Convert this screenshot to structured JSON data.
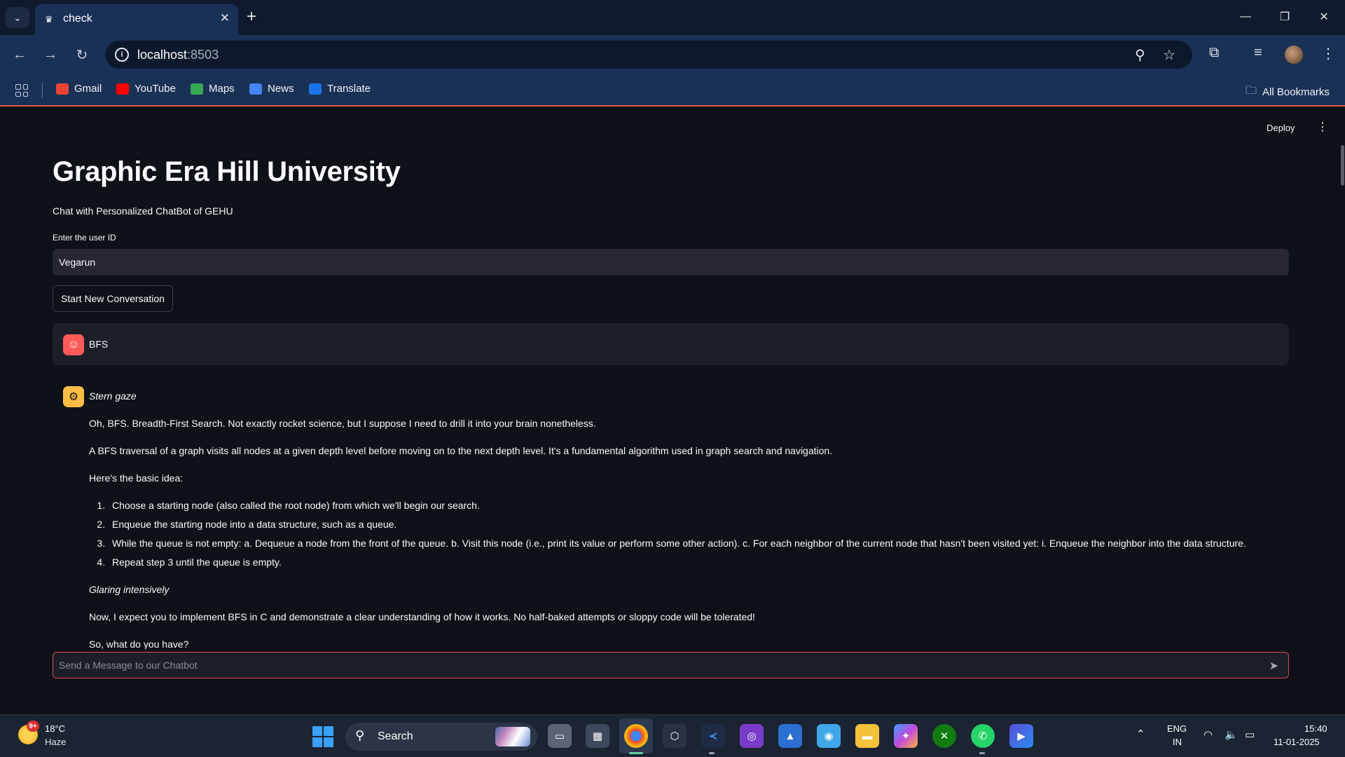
{
  "browser": {
    "tab_title": "check",
    "new_tab_icon": "+",
    "url_host": "localhost",
    "url_port": ":8503",
    "bookmarks": [
      {
        "label": "Gmail",
        "color": "#ea4335"
      },
      {
        "label": "YouTube",
        "color": "#ff0000"
      },
      {
        "label": "Maps",
        "color": "#34a853"
      },
      {
        "label": "News",
        "color": "#4285f4"
      },
      {
        "label": "Translate",
        "color": "#4285f4"
      }
    ],
    "all_bookmarks": "All Bookmarks"
  },
  "app": {
    "deploy_label": "Deploy",
    "title": "Graphic Era Hill University",
    "subtitle": "Chat with Personalized ChatBot of GEHU",
    "user_id_label": "Enter the user ID",
    "user_id_value": "Vegarun",
    "new_conversation_label": "Start New Conversation",
    "user_message": "BFS",
    "assistant": {
      "p1": "Stern gaze",
      "p2": "Oh, BFS. Breadth-First Search. Not exactly rocket science, but I suppose I need to drill it into your brain nonetheless.",
      "p3": "A BFS traversal of a graph visits all nodes at a given depth level before moving on to the next depth level. It's a fundamental algorithm used in graph search and navigation.",
      "p4": "Here's the basic idea:",
      "steps": [
        "Choose a starting node (also called the root node) from which we'll begin our search.",
        "Enqueue the starting node into a data structure, such as a queue.",
        "While the queue is not empty: a. Dequeue a node from the front of the queue. b. Visit this node (i.e., print its value or perform some other action). c. For each neighbor of the current node that hasn't been visited yet: i. Enqueue the neighbor into the data structure.",
        "Repeat step 3 until the queue is empty."
      ],
      "p5": "Glaring intensively",
      "p6": "Now, I expect you to implement BFS in C and demonstrate a clear understanding of how it works. No half-baked attempts or sloppy code will be tolerated!",
      "p7": "So, what do you have?"
    },
    "chat_placeholder": "Send a Message to our Chatbot",
    "accent_color": "#ff4b4b"
  },
  "taskbar": {
    "weather_badge": "9+",
    "temperature": "18°C",
    "condition": "Haze",
    "search_label": "Search",
    "lang_top": "ENG",
    "lang_bottom": "IN",
    "time": "15:40",
    "date": "11-01-2025"
  }
}
